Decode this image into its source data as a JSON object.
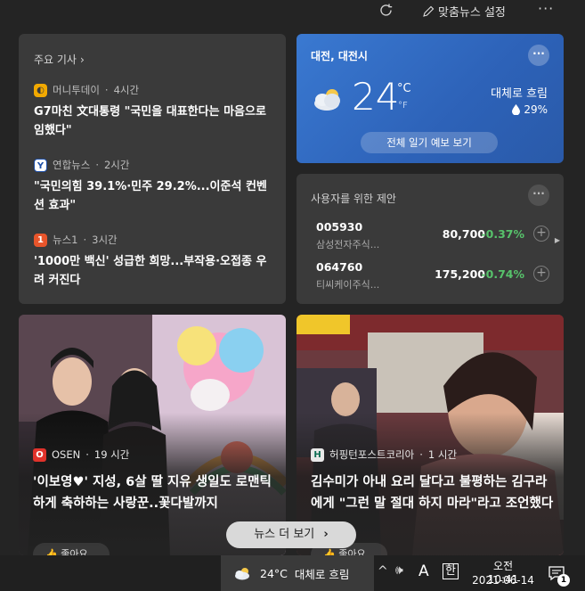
{
  "toolbar": {
    "refresh_icon": "refresh-icon",
    "personalize_label": "맞춤뉴스 설정",
    "more_label": "···"
  },
  "top_stories": {
    "header": "주요 기사",
    "items": [
      {
        "source": "머니투데이",
        "time": "4시간",
        "logo_color": "#f2a900",
        "headline": "G7마친 文대통령 \"국민을 대표한다는 마음으로 임했다\""
      },
      {
        "source": "연합뉴스",
        "time": "2시간",
        "logo_color": "#1d4fa8",
        "headline": "\"국민의힘 39.1%·민주 29.2%...이준석 컨벤션 효과\""
      },
      {
        "source": "뉴스1",
        "time": "3시간",
        "logo_color": "#e8552b",
        "headline": "'1000만 백신' 성급한 희망...부작용·오접종 우려 커진다"
      }
    ]
  },
  "weather": {
    "location": "대전, 대전시",
    "more_label": "···",
    "temp": "24",
    "unit_c": "°C",
    "unit_f": "°F",
    "condition": "대체로 흐림",
    "humidity": "29%",
    "forecast_button": "전체 일기 예보 보기"
  },
  "stocks": {
    "header": "사용자를 위한 제안",
    "more_label": "···",
    "items": [
      {
        "symbol": "005930",
        "name": "삼성전자주식...",
        "price": "80,700",
        "change": "-0.37%",
        "change_color": "#57c26b"
      },
      {
        "symbol": "064760",
        "name": "티씨케이주식...",
        "price": "175,200",
        "change": "-0.74%",
        "change_color": "#57c26b"
      }
    ]
  },
  "photo_cards": [
    {
      "source": "OSEN",
      "time": "19 시간",
      "logo_color": "#e0322b",
      "logo_char": "O",
      "headline": "'이보영♥' 지성, 6살 딸 지유 생일도 로맨틱하게 축하하는 사랑꾼..꽃다발까지",
      "like_label": "좋아요"
    },
    {
      "source": "허핑턴포스트코리아",
      "time": "1 시간",
      "logo_color": "#0b6b52",
      "logo_char": "H",
      "headline": "김수미가 아내 요리 달다고 불평하는 김구라에게 \"그런 말 절대 하지 마라\"라고 조언했다",
      "like_label": "좋아요"
    }
  ],
  "see_more": {
    "label": "뉴스 더 보기",
    "chevron": "›"
  },
  "taskbar": {
    "weather_temp": "24°C",
    "weather_condition": "대체로 흐림",
    "chevron": "^",
    "volume_icon": "volume-icon",
    "ime_a": "A",
    "ime_han": "한",
    "time": "오전 10:41",
    "date": "2021-06-14",
    "notification_count": "1"
  }
}
